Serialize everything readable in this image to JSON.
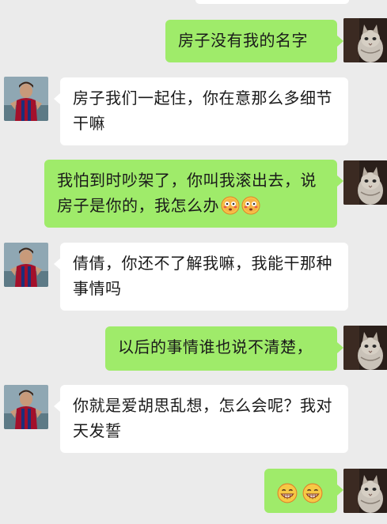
{
  "messages": [
    {
      "side": "right",
      "text": "房子没有我的名字"
    },
    {
      "side": "left",
      "text": "房子我们一起住，你在意那么多细节干嘛"
    },
    {
      "side": "right",
      "text": "我怕到时吵架了，你叫我滚出去，说房子是你的，我怎么办"
    },
    {
      "side": "left",
      "text": "倩倩，你还不了解我嘛，我能干那种事情吗"
    },
    {
      "side": "right",
      "text": "以后的事情谁也说不清楚，"
    },
    {
      "side": "left",
      "text": "你就是爱胡思乱想，怎么会呢？我对天发誓"
    }
  ],
  "icons": {
    "blush_emoji": "flushed-face-emoji-icon",
    "grin_emoji": "grinning-face-emoji-icon",
    "left_avatar": "soccer-player-avatar",
    "right_avatar": "cat-avatar"
  },
  "colors": {
    "background": "#ebebeb",
    "incoming_bubble": "#ffffff",
    "outgoing_bubble": "#9feb6a"
  }
}
